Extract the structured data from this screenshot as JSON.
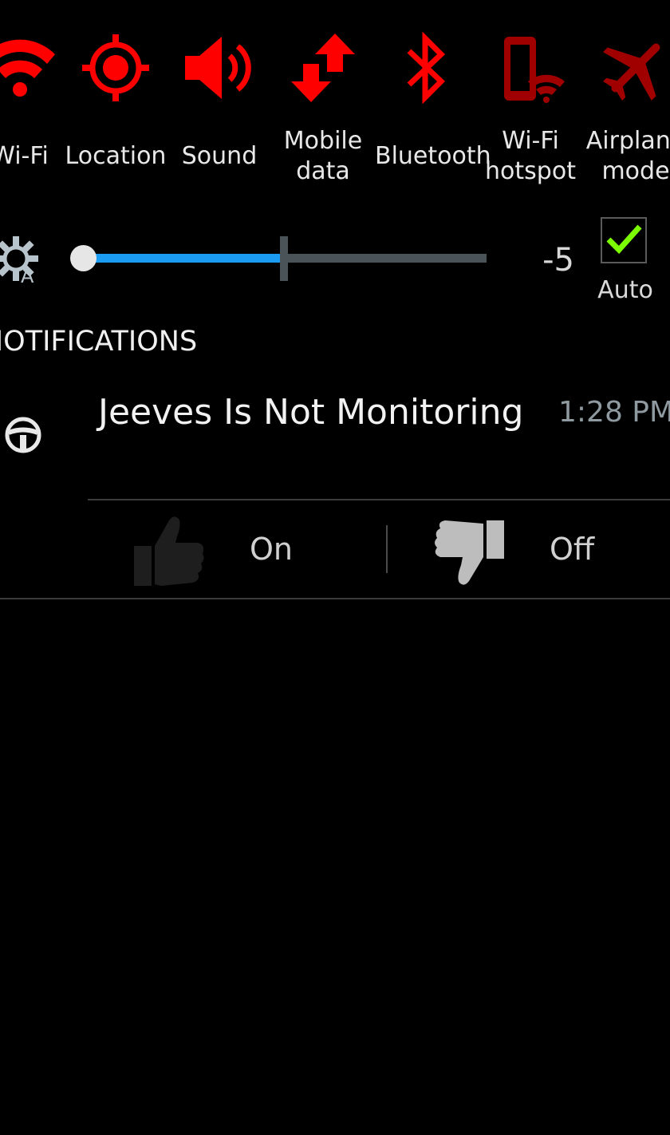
{
  "quick_settings": [
    {
      "id": "wifi",
      "label": "Wi-Fi",
      "icon": "wifi-icon",
      "color": "#ff0000"
    },
    {
      "id": "location",
      "label": "Location",
      "icon": "location-icon",
      "color": "#ff0000"
    },
    {
      "id": "sound",
      "label": "Sound",
      "icon": "sound-icon",
      "color": "#ff0000"
    },
    {
      "id": "mobile_data",
      "label": "Mobile\ndata",
      "icon": "mobile-data-icon",
      "color": "#ff0000"
    },
    {
      "id": "bluetooth",
      "label": "Bluetooth",
      "icon": "bluetooth-icon",
      "color": "#ff0000"
    },
    {
      "id": "hotspot",
      "label": "Wi-Fi\nhotspot",
      "icon": "hotspot-icon",
      "color": "#a00000"
    },
    {
      "id": "airplane",
      "label": "Airplane\nmode",
      "icon": "airplane-icon",
      "color": "#a00000"
    }
  ],
  "brightness": {
    "value_label": "-5",
    "level": 0.5,
    "auto_label": "Auto",
    "auto_checked": true,
    "accent_color": "#1b9cf2",
    "check_color": "#7cfc00"
  },
  "notifications": {
    "header": "NOTIFICATIONS",
    "items": [
      {
        "title": "Jeeves Is Not Monitoring",
        "time": "1:28 PM",
        "icon": "steering-wheel-icon",
        "actions": [
          {
            "label": "On",
            "icon": "thumbs-up-icon"
          },
          {
            "label": "Off",
            "icon": "thumbs-down-icon"
          }
        ]
      }
    ]
  }
}
